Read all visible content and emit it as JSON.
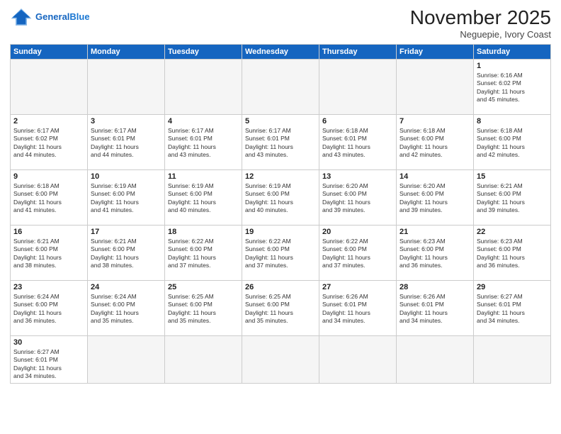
{
  "header": {
    "logo_general": "General",
    "logo_blue": "Blue",
    "month_title": "November 2025",
    "subtitle": "Neguepie, Ivory Coast"
  },
  "weekdays": [
    "Sunday",
    "Monday",
    "Tuesday",
    "Wednesday",
    "Thursday",
    "Friday",
    "Saturday"
  ],
  "weeks": [
    [
      {
        "day": "",
        "info": ""
      },
      {
        "day": "",
        "info": ""
      },
      {
        "day": "",
        "info": ""
      },
      {
        "day": "",
        "info": ""
      },
      {
        "day": "",
        "info": ""
      },
      {
        "day": "",
        "info": ""
      },
      {
        "day": "1",
        "info": "Sunrise: 6:16 AM\nSunset: 6:02 PM\nDaylight: 11 hours\nand 45 minutes."
      }
    ],
    [
      {
        "day": "2",
        "info": "Sunrise: 6:17 AM\nSunset: 6:02 PM\nDaylight: 11 hours\nand 44 minutes."
      },
      {
        "day": "3",
        "info": "Sunrise: 6:17 AM\nSunset: 6:01 PM\nDaylight: 11 hours\nand 44 minutes."
      },
      {
        "day": "4",
        "info": "Sunrise: 6:17 AM\nSunset: 6:01 PM\nDaylight: 11 hours\nand 43 minutes."
      },
      {
        "day": "5",
        "info": "Sunrise: 6:17 AM\nSunset: 6:01 PM\nDaylight: 11 hours\nand 43 minutes."
      },
      {
        "day": "6",
        "info": "Sunrise: 6:18 AM\nSunset: 6:01 PM\nDaylight: 11 hours\nand 43 minutes."
      },
      {
        "day": "7",
        "info": "Sunrise: 6:18 AM\nSunset: 6:00 PM\nDaylight: 11 hours\nand 42 minutes."
      },
      {
        "day": "8",
        "info": "Sunrise: 6:18 AM\nSunset: 6:00 PM\nDaylight: 11 hours\nand 42 minutes."
      }
    ],
    [
      {
        "day": "9",
        "info": "Sunrise: 6:18 AM\nSunset: 6:00 PM\nDaylight: 11 hours\nand 41 minutes."
      },
      {
        "day": "10",
        "info": "Sunrise: 6:19 AM\nSunset: 6:00 PM\nDaylight: 11 hours\nand 41 minutes."
      },
      {
        "day": "11",
        "info": "Sunrise: 6:19 AM\nSunset: 6:00 PM\nDaylight: 11 hours\nand 40 minutes."
      },
      {
        "day": "12",
        "info": "Sunrise: 6:19 AM\nSunset: 6:00 PM\nDaylight: 11 hours\nand 40 minutes."
      },
      {
        "day": "13",
        "info": "Sunrise: 6:20 AM\nSunset: 6:00 PM\nDaylight: 11 hours\nand 39 minutes."
      },
      {
        "day": "14",
        "info": "Sunrise: 6:20 AM\nSunset: 6:00 PM\nDaylight: 11 hours\nand 39 minutes."
      },
      {
        "day": "15",
        "info": "Sunrise: 6:21 AM\nSunset: 6:00 PM\nDaylight: 11 hours\nand 39 minutes."
      }
    ],
    [
      {
        "day": "16",
        "info": "Sunrise: 6:21 AM\nSunset: 6:00 PM\nDaylight: 11 hours\nand 38 minutes."
      },
      {
        "day": "17",
        "info": "Sunrise: 6:21 AM\nSunset: 6:00 PM\nDaylight: 11 hours\nand 38 minutes."
      },
      {
        "day": "18",
        "info": "Sunrise: 6:22 AM\nSunset: 6:00 PM\nDaylight: 11 hours\nand 37 minutes."
      },
      {
        "day": "19",
        "info": "Sunrise: 6:22 AM\nSunset: 6:00 PM\nDaylight: 11 hours\nand 37 minutes."
      },
      {
        "day": "20",
        "info": "Sunrise: 6:22 AM\nSunset: 6:00 PM\nDaylight: 11 hours\nand 37 minutes."
      },
      {
        "day": "21",
        "info": "Sunrise: 6:23 AM\nSunset: 6:00 PM\nDaylight: 11 hours\nand 36 minutes."
      },
      {
        "day": "22",
        "info": "Sunrise: 6:23 AM\nSunset: 6:00 PM\nDaylight: 11 hours\nand 36 minutes."
      }
    ],
    [
      {
        "day": "23",
        "info": "Sunrise: 6:24 AM\nSunset: 6:00 PM\nDaylight: 11 hours\nand 36 minutes."
      },
      {
        "day": "24",
        "info": "Sunrise: 6:24 AM\nSunset: 6:00 PM\nDaylight: 11 hours\nand 35 minutes."
      },
      {
        "day": "25",
        "info": "Sunrise: 6:25 AM\nSunset: 6:00 PM\nDaylight: 11 hours\nand 35 minutes."
      },
      {
        "day": "26",
        "info": "Sunrise: 6:25 AM\nSunset: 6:00 PM\nDaylight: 11 hours\nand 35 minutes."
      },
      {
        "day": "27",
        "info": "Sunrise: 6:26 AM\nSunset: 6:01 PM\nDaylight: 11 hours\nand 34 minutes."
      },
      {
        "day": "28",
        "info": "Sunrise: 6:26 AM\nSunset: 6:01 PM\nDaylight: 11 hours\nand 34 minutes."
      },
      {
        "day": "29",
        "info": "Sunrise: 6:27 AM\nSunset: 6:01 PM\nDaylight: 11 hours\nand 34 minutes."
      }
    ],
    [
      {
        "day": "30",
        "info": "Sunrise: 6:27 AM\nSunset: 6:01 PM\nDaylight: 11 hours\nand 34 minutes."
      },
      {
        "day": "",
        "info": ""
      },
      {
        "day": "",
        "info": ""
      },
      {
        "day": "",
        "info": ""
      },
      {
        "day": "",
        "info": ""
      },
      {
        "day": "",
        "info": ""
      },
      {
        "day": "",
        "info": ""
      }
    ]
  ]
}
